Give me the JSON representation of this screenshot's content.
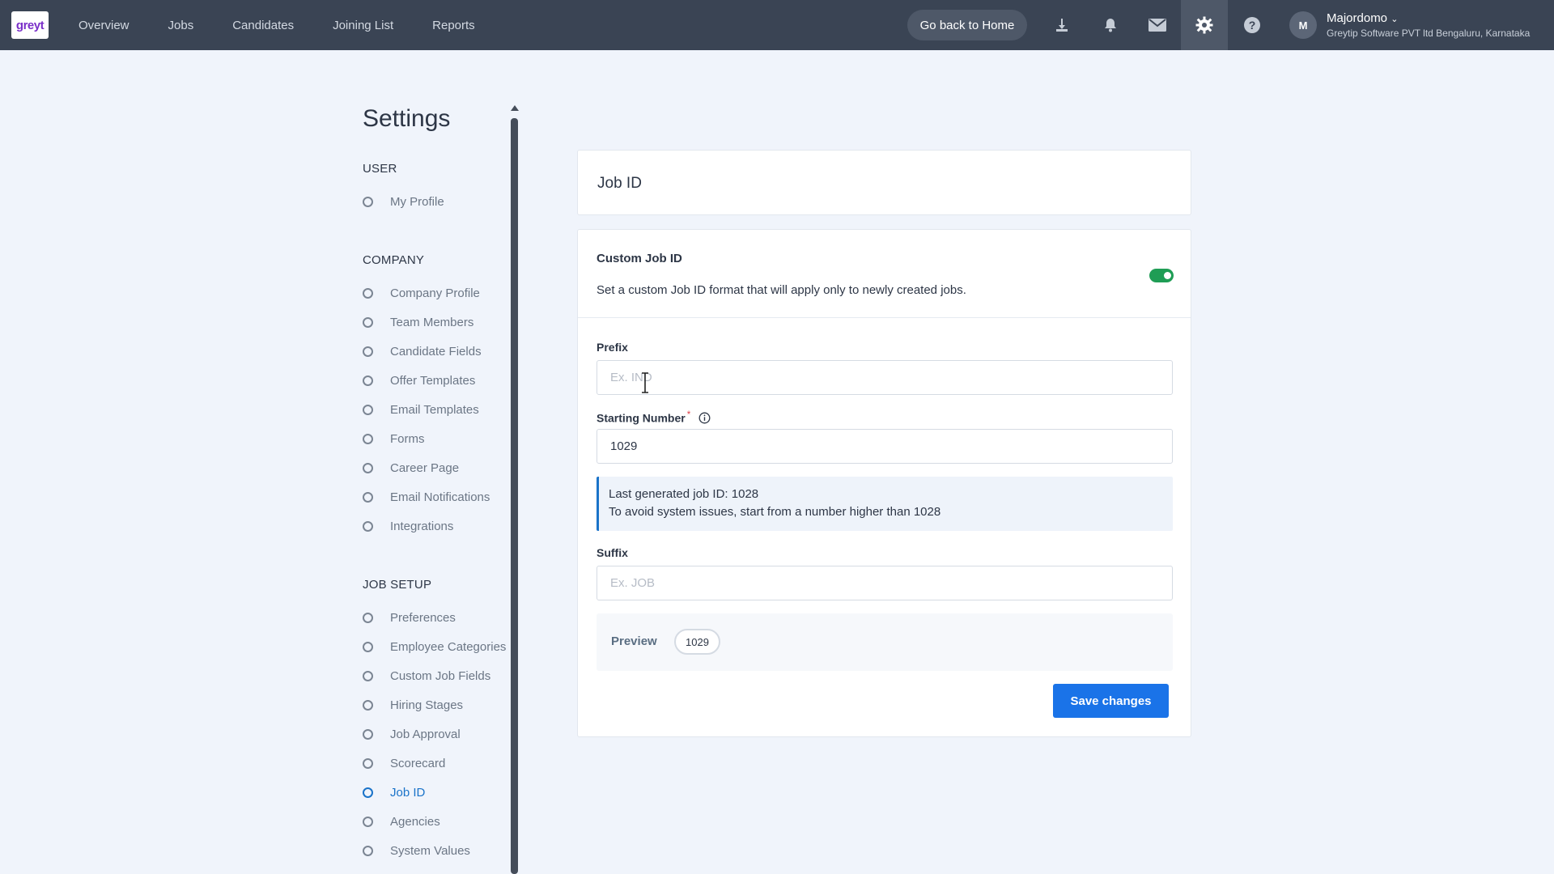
{
  "app": {
    "logo_text": "greyt",
    "nav": [
      "Overview",
      "Jobs",
      "Candidates",
      "Joining List",
      "Reports"
    ],
    "home_button": "Go back to Home",
    "user": {
      "initial": "M",
      "name": "Majordomo",
      "org": "Greytip Software PVT ltd Bengaluru, Karnataka"
    },
    "icons": [
      "download-icon",
      "bell-icon",
      "mail-icon",
      "gear-icon",
      "help-icon"
    ]
  },
  "sidebar": {
    "title": "Settings",
    "sections": [
      {
        "heading": "USER",
        "items": [
          "My Profile"
        ]
      },
      {
        "heading": "COMPANY",
        "items": [
          "Company Profile",
          "Team Members",
          "Candidate Fields",
          "Offer Templates",
          "Email Templates",
          "Forms",
          "Career Page",
          "Email Notifications",
          "Integrations"
        ]
      },
      {
        "heading": "JOB SETUP",
        "items": [
          "Preferences",
          "Employee Categories",
          "Custom Job Fields",
          "Hiring Stages",
          "Job Approval",
          "Scorecard",
          "Job ID",
          "Agencies",
          "System Values"
        ]
      }
    ],
    "active_item": "Job ID"
  },
  "main": {
    "page_title": "Job ID",
    "custom": {
      "title": "Custom Job ID",
      "description": "Set a custom Job ID format that will apply only to newly created jobs.",
      "enabled": true,
      "accent": "#1f9d55"
    },
    "prefix": {
      "label": "Prefix",
      "placeholder": "Ex. IND",
      "value": ""
    },
    "starting": {
      "label": "Starting Number",
      "required_mark": "*",
      "value": "1029"
    },
    "info": {
      "line1": "Last generated job ID: 1028",
      "line2": "To avoid system issues, start from a number higher than 1028"
    },
    "suffix": {
      "label": "Suffix",
      "placeholder": "Ex. JOB",
      "value": ""
    },
    "preview": {
      "label": "Preview",
      "value": "1029"
    },
    "save_label": "Save changes"
  }
}
